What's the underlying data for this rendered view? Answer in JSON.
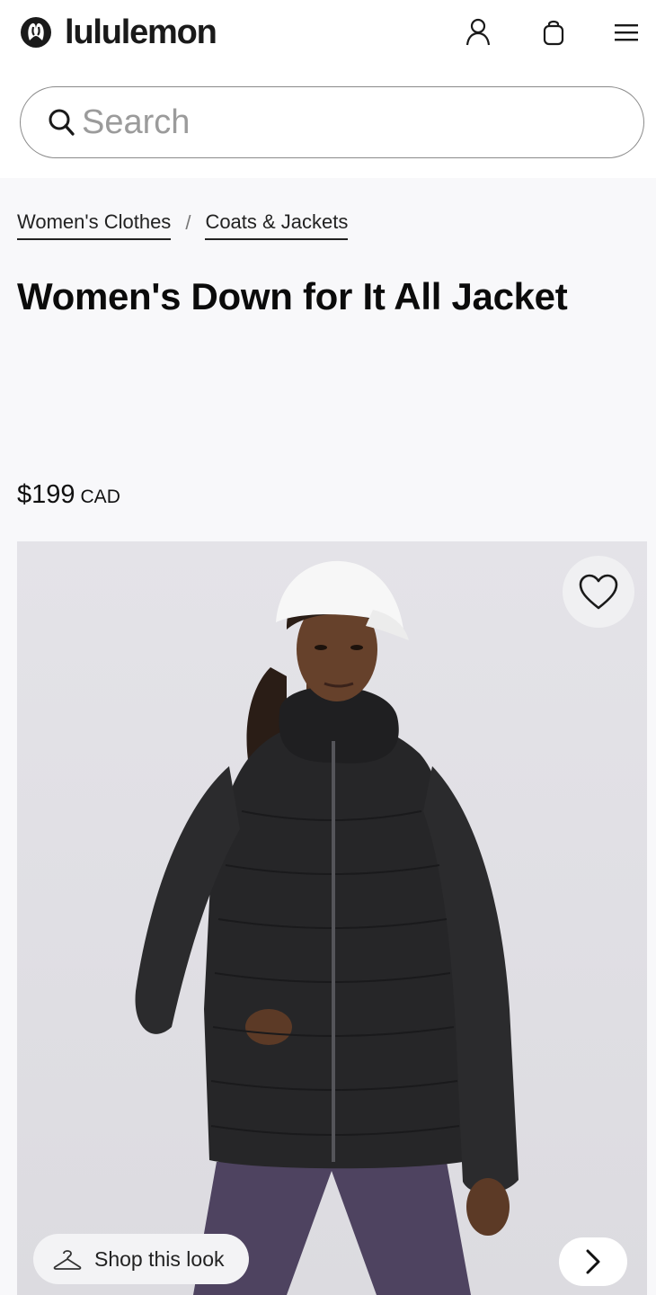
{
  "header": {
    "brand": "lululemon",
    "icons": [
      "logo-icon",
      "account-icon",
      "bag-icon",
      "menu-icon"
    ]
  },
  "search": {
    "placeholder": "Search",
    "value": ""
  },
  "breadcrumb": [
    {
      "label": "Women's Clothes"
    },
    {
      "label": "Coats & Jackets"
    }
  ],
  "breadcrumb_separator": "/",
  "product": {
    "title": "Women's Down for It All Jacket",
    "price": "$199",
    "currency": "CAD"
  },
  "gallery": {
    "shop_look_label": "Shop this look",
    "icons": [
      "heart-icon",
      "hanger-icon",
      "chevron-right-icon"
    ]
  },
  "colors": {
    "accent": "#d31f2a",
    "text": "#111111",
    "page_bg": "#f8f8fa"
  }
}
